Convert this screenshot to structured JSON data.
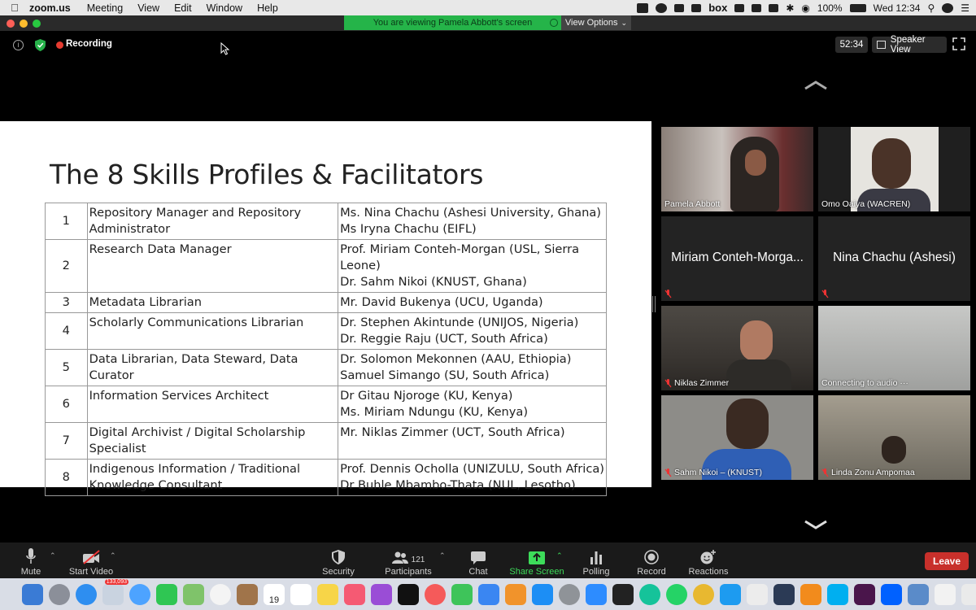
{
  "menubar": {
    "app_name": "zoom.us",
    "items": [
      "Meeting",
      "View",
      "Edit",
      "Window",
      "Help"
    ],
    "box_label": "box",
    "battery": "100%",
    "clock": "Wed 12:34"
  },
  "banner": {
    "viewing_text": "You are viewing Pamela Abbott's screen",
    "view_options": "View Options"
  },
  "meeting": {
    "recording_label": "Recording",
    "timer": "52:34",
    "speaker_view": "Speaker View"
  },
  "slide": {
    "title": "The 8 Skills Profiles & Facilitators",
    "rows": [
      {
        "num": "1",
        "role": "Repository Manager and Repository Administrator",
        "facilitators": [
          "Ms. Nina Chachu (Ashesi University, Ghana)",
          "Ms Iryna Chachu (EIFL)"
        ]
      },
      {
        "num": "2",
        "role": "Research Data Manager",
        "facilitators": [
          "Prof. Miriam Conteh-Morgan (USL, Sierra",
          "Leone)",
          "Dr. Sahm Nikoi (KNUST, Ghana)"
        ]
      },
      {
        "num": "3",
        "role": "Metadata Librarian",
        "facilitators": [
          "Mr. David Bukenya (UCU, Uganda)"
        ]
      },
      {
        "num": "4",
        "role": "Scholarly Communications Librarian",
        "facilitators": [
          "Dr. Stephen Akintunde (UNIJOS, Nigeria)",
          "Dr. Reggie Raju (UCT, South Africa)"
        ]
      },
      {
        "num": "5",
        "role": "Data Librarian, Data Steward, Data Curator",
        "facilitators": [
          "Dr. Solomon Mekonnen (AAU, Ethiopia)",
          "Samuel Simango (SU, South Africa)"
        ]
      },
      {
        "num": "6",
        "role": "Information Services Architect",
        "facilitators": [
          "Dr Gitau Njoroge (KU, Kenya)",
          "Ms. Miriam Ndungu (KU, Kenya)"
        ]
      },
      {
        "num": "7",
        "role": "Digital Archivist / Digital Scholarship Specialist",
        "facilitators": [
          "Mr. Niklas Zimmer (UCT, South Africa)"
        ]
      },
      {
        "num": "8",
        "role": "Indigenous Information / Traditional Knowledge Consultant",
        "facilitators": [
          "Prof. Dennis Ocholla (UNIZULU, South Africa)",
          "Dr Buhle Mbambo-Thata (NUL, Lesotho)"
        ]
      }
    ]
  },
  "participants": [
    {
      "name": "Pamela Abbott",
      "video": true,
      "active": true,
      "muted": false
    },
    {
      "name": "Omo Oaiya (WACREN)",
      "video": true,
      "active": false,
      "muted": false
    },
    {
      "name": "",
      "big_label": "Miriam Conteh-Morga...",
      "video": false,
      "muted": true
    },
    {
      "name": "",
      "big_label": "Nina Chachu (Ashesi)",
      "video": false,
      "muted": true
    },
    {
      "name": "Niklas Zimmer",
      "video": true,
      "muted": true
    },
    {
      "name": "Connecting to audio ···",
      "video": true,
      "muted": false
    },
    {
      "name": "Sahm Nikoi – (KNUST)",
      "video": true,
      "muted": true
    },
    {
      "name": "Linda Zonu Ampomaa",
      "video": true,
      "muted": true
    }
  ],
  "toolbar": {
    "mute": "Mute",
    "start_video": "Start Video",
    "security": "Security",
    "participants": "Participants",
    "participants_count": "121",
    "chat": "Chat",
    "share_screen": "Share Screen",
    "polling": "Polling",
    "record": "Record",
    "reactions": "Reactions",
    "leave": "Leave"
  },
  "dock": {
    "mail_badge": "133,093",
    "calendar_day": "19"
  },
  "colors": {
    "active_speaker": "#f0ee5a",
    "banner_green": "#25b449",
    "recording_red": "#e53b30",
    "leave_red": "#c8302b",
    "share_green": "#3ddc5a"
  }
}
